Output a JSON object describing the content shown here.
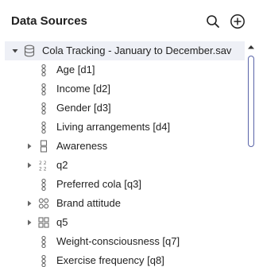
{
  "header": {
    "title": "Data Sources"
  },
  "tree": {
    "root": {
      "label": "Cola Tracking - January to December.sav",
      "icon": "database-icon",
      "expanded": true
    },
    "items": [
      {
        "label": "Age [d1]",
        "icon": "numeric-variable-icon",
        "expandable": false
      },
      {
        "label": "Income [d2]",
        "icon": "numeric-variable-icon",
        "expandable": false
      },
      {
        "label": "Gender [d3]",
        "icon": "numeric-variable-icon",
        "expandable": false
      },
      {
        "label": "Living arrangements [d4]",
        "icon": "numeric-variable-icon",
        "expandable": false
      },
      {
        "label": "Awareness",
        "icon": "multiple-response-icon",
        "expandable": true
      },
      {
        "label": "q2",
        "icon": "number-grid-icon",
        "expandable": true
      },
      {
        "label": "Preferred cola [q3]",
        "icon": "numeric-variable-icon",
        "expandable": false
      },
      {
        "label": "Brand attitude",
        "icon": "circle-grid-icon",
        "expandable": true
      },
      {
        "label": "q5",
        "icon": "square-grid-icon",
        "expandable": true
      },
      {
        "label": "Weight-consciousness [q7]",
        "icon": "numeric-variable-icon",
        "expandable": false
      },
      {
        "label": "Exercise frequency [q8]",
        "icon": "numeric-variable-icon",
        "expandable": false
      }
    ]
  },
  "colors": {
    "root_row_bg": "#eef0f6",
    "scrollbar": "#5a64a8",
    "icon": "#6b6b6b"
  }
}
